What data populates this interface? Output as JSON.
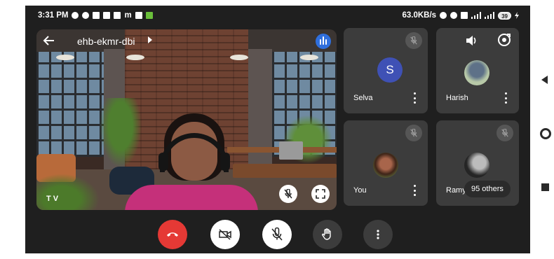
{
  "status_bar": {
    "time": "3:31 PM",
    "app_glyph": "m",
    "network_speed": "63.0KB/s",
    "battery": "39"
  },
  "meeting": {
    "title": "ehb-ekmr-dbi",
    "main_speaker_name": "T V"
  },
  "participants": [
    {
      "name": "Selva",
      "initial": "S",
      "muted": true
    },
    {
      "name": "Harish",
      "muted": false
    },
    {
      "name": "You",
      "muted": true
    },
    {
      "name": "Ramya",
      "muted": true
    }
  ],
  "others_badge": "95 others",
  "colors": {
    "end_call": "#e53935",
    "tile_background": "#3c3c3c",
    "avatar_selva": "#3f51b5",
    "active_speaker": "#2f6fdd"
  },
  "icons": [
    "back-arrow-icon",
    "chevron-right-icon",
    "speaker-activity-icon",
    "mic-off-icon",
    "fullscreen-icon",
    "volume-icon",
    "camera-switch-icon",
    "more-vert-icon",
    "end-call-icon",
    "camera-off-icon",
    "raise-hand-icon"
  ]
}
